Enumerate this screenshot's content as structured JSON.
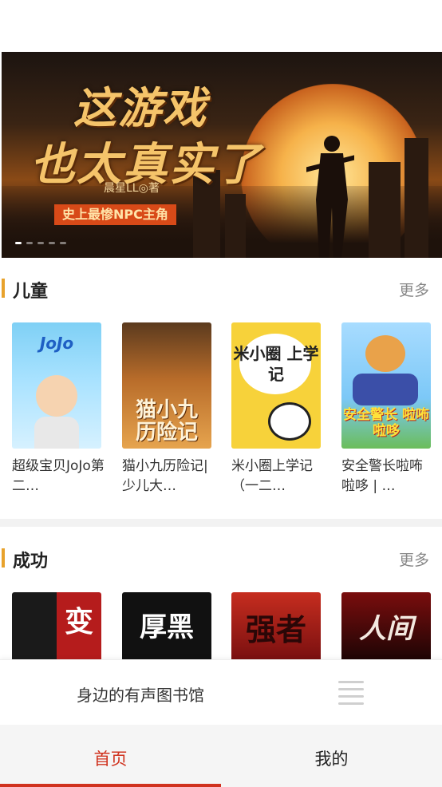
{
  "banner": {
    "title_line1": "这游戏",
    "title_line2": "也太真实了",
    "author": "晨星LL◎著",
    "tagline": "史上最惨NPC主角",
    "slide_count": 5,
    "active_slide": 1
  },
  "sections": [
    {
      "title": "儿童",
      "more_label": "更多",
      "books": [
        {
          "title": "超级宝贝JoJo第二…",
          "cover_text": "JoJo"
        },
        {
          "title": "猫小九历险记|少儿大…",
          "cover_text": "猫小九 历险记"
        },
        {
          "title": "米小圈上学记（一二…",
          "cover_text": "米小圈 上学记"
        },
        {
          "title": "安全警长啦咘啦哆 | …",
          "cover_text": "安全警长 啦咘啦哆"
        }
      ]
    },
    {
      "title": "成功",
      "more_label": "更多",
      "books": [
        {
          "cover_text": "变"
        },
        {
          "cover_text": "厚黑"
        },
        {
          "cover_text": "强者"
        },
        {
          "cover_text": "人间"
        }
      ]
    }
  ],
  "player": {
    "title": "身边的有声图书馆",
    "menu_icon": "list-icon"
  },
  "tabs": [
    {
      "label": "首页",
      "active": true
    },
    {
      "label": "我的",
      "active": false
    }
  ],
  "colors": {
    "accent": "#d0321e",
    "section_bar": "#e8a22c"
  }
}
